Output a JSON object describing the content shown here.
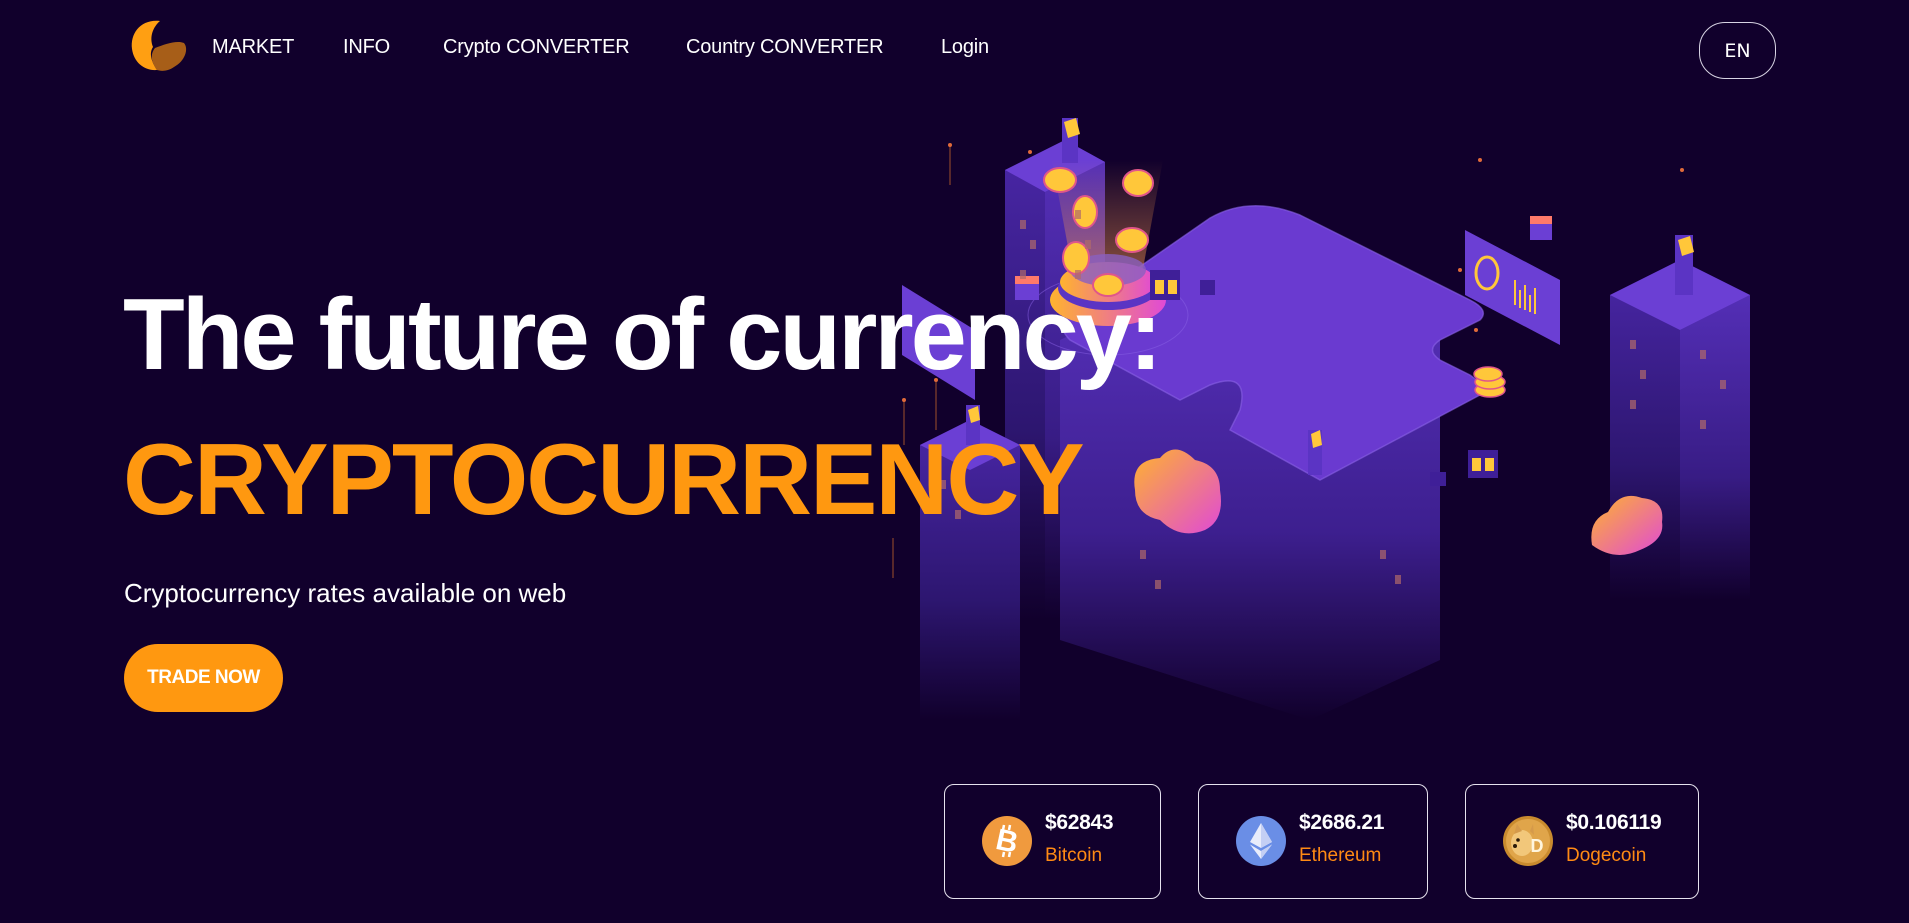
{
  "colors": {
    "background": "#11002c",
    "accent": "#ff9810",
    "coin_label": "#ff8a14",
    "illustration_purple": "#6a3ad0"
  },
  "brand": {
    "logo_icon": "orange-crescent-logo"
  },
  "nav": {
    "links": [
      {
        "label": "MARKET"
      },
      {
        "label": "INFO"
      },
      {
        "label": "Crypto CONVERTER"
      },
      {
        "label": "Country CONVERTER"
      },
      {
        "label": "Login"
      }
    ],
    "language": "EN"
  },
  "hero": {
    "title": "The future of currency:",
    "highlight": "CRYPTOCURRENCY",
    "subtitle": "Cryptocurrency rates available on web",
    "cta": "TRADE NOW",
    "illustration": "isometric-crypto-city"
  },
  "coins": [
    {
      "price": "$62843",
      "name": "Bitcoin",
      "icon": "bitcoin-icon",
      "icon_color": "#f09a3e"
    },
    {
      "price": "$2686.21",
      "name": "Ethereum",
      "icon": "ethereum-icon",
      "icon_color": "#6a8ee6"
    },
    {
      "price": "$0.106119",
      "name": "Dogecoin",
      "icon": "dogecoin-icon",
      "icon_color": "#c98b2e"
    }
  ]
}
